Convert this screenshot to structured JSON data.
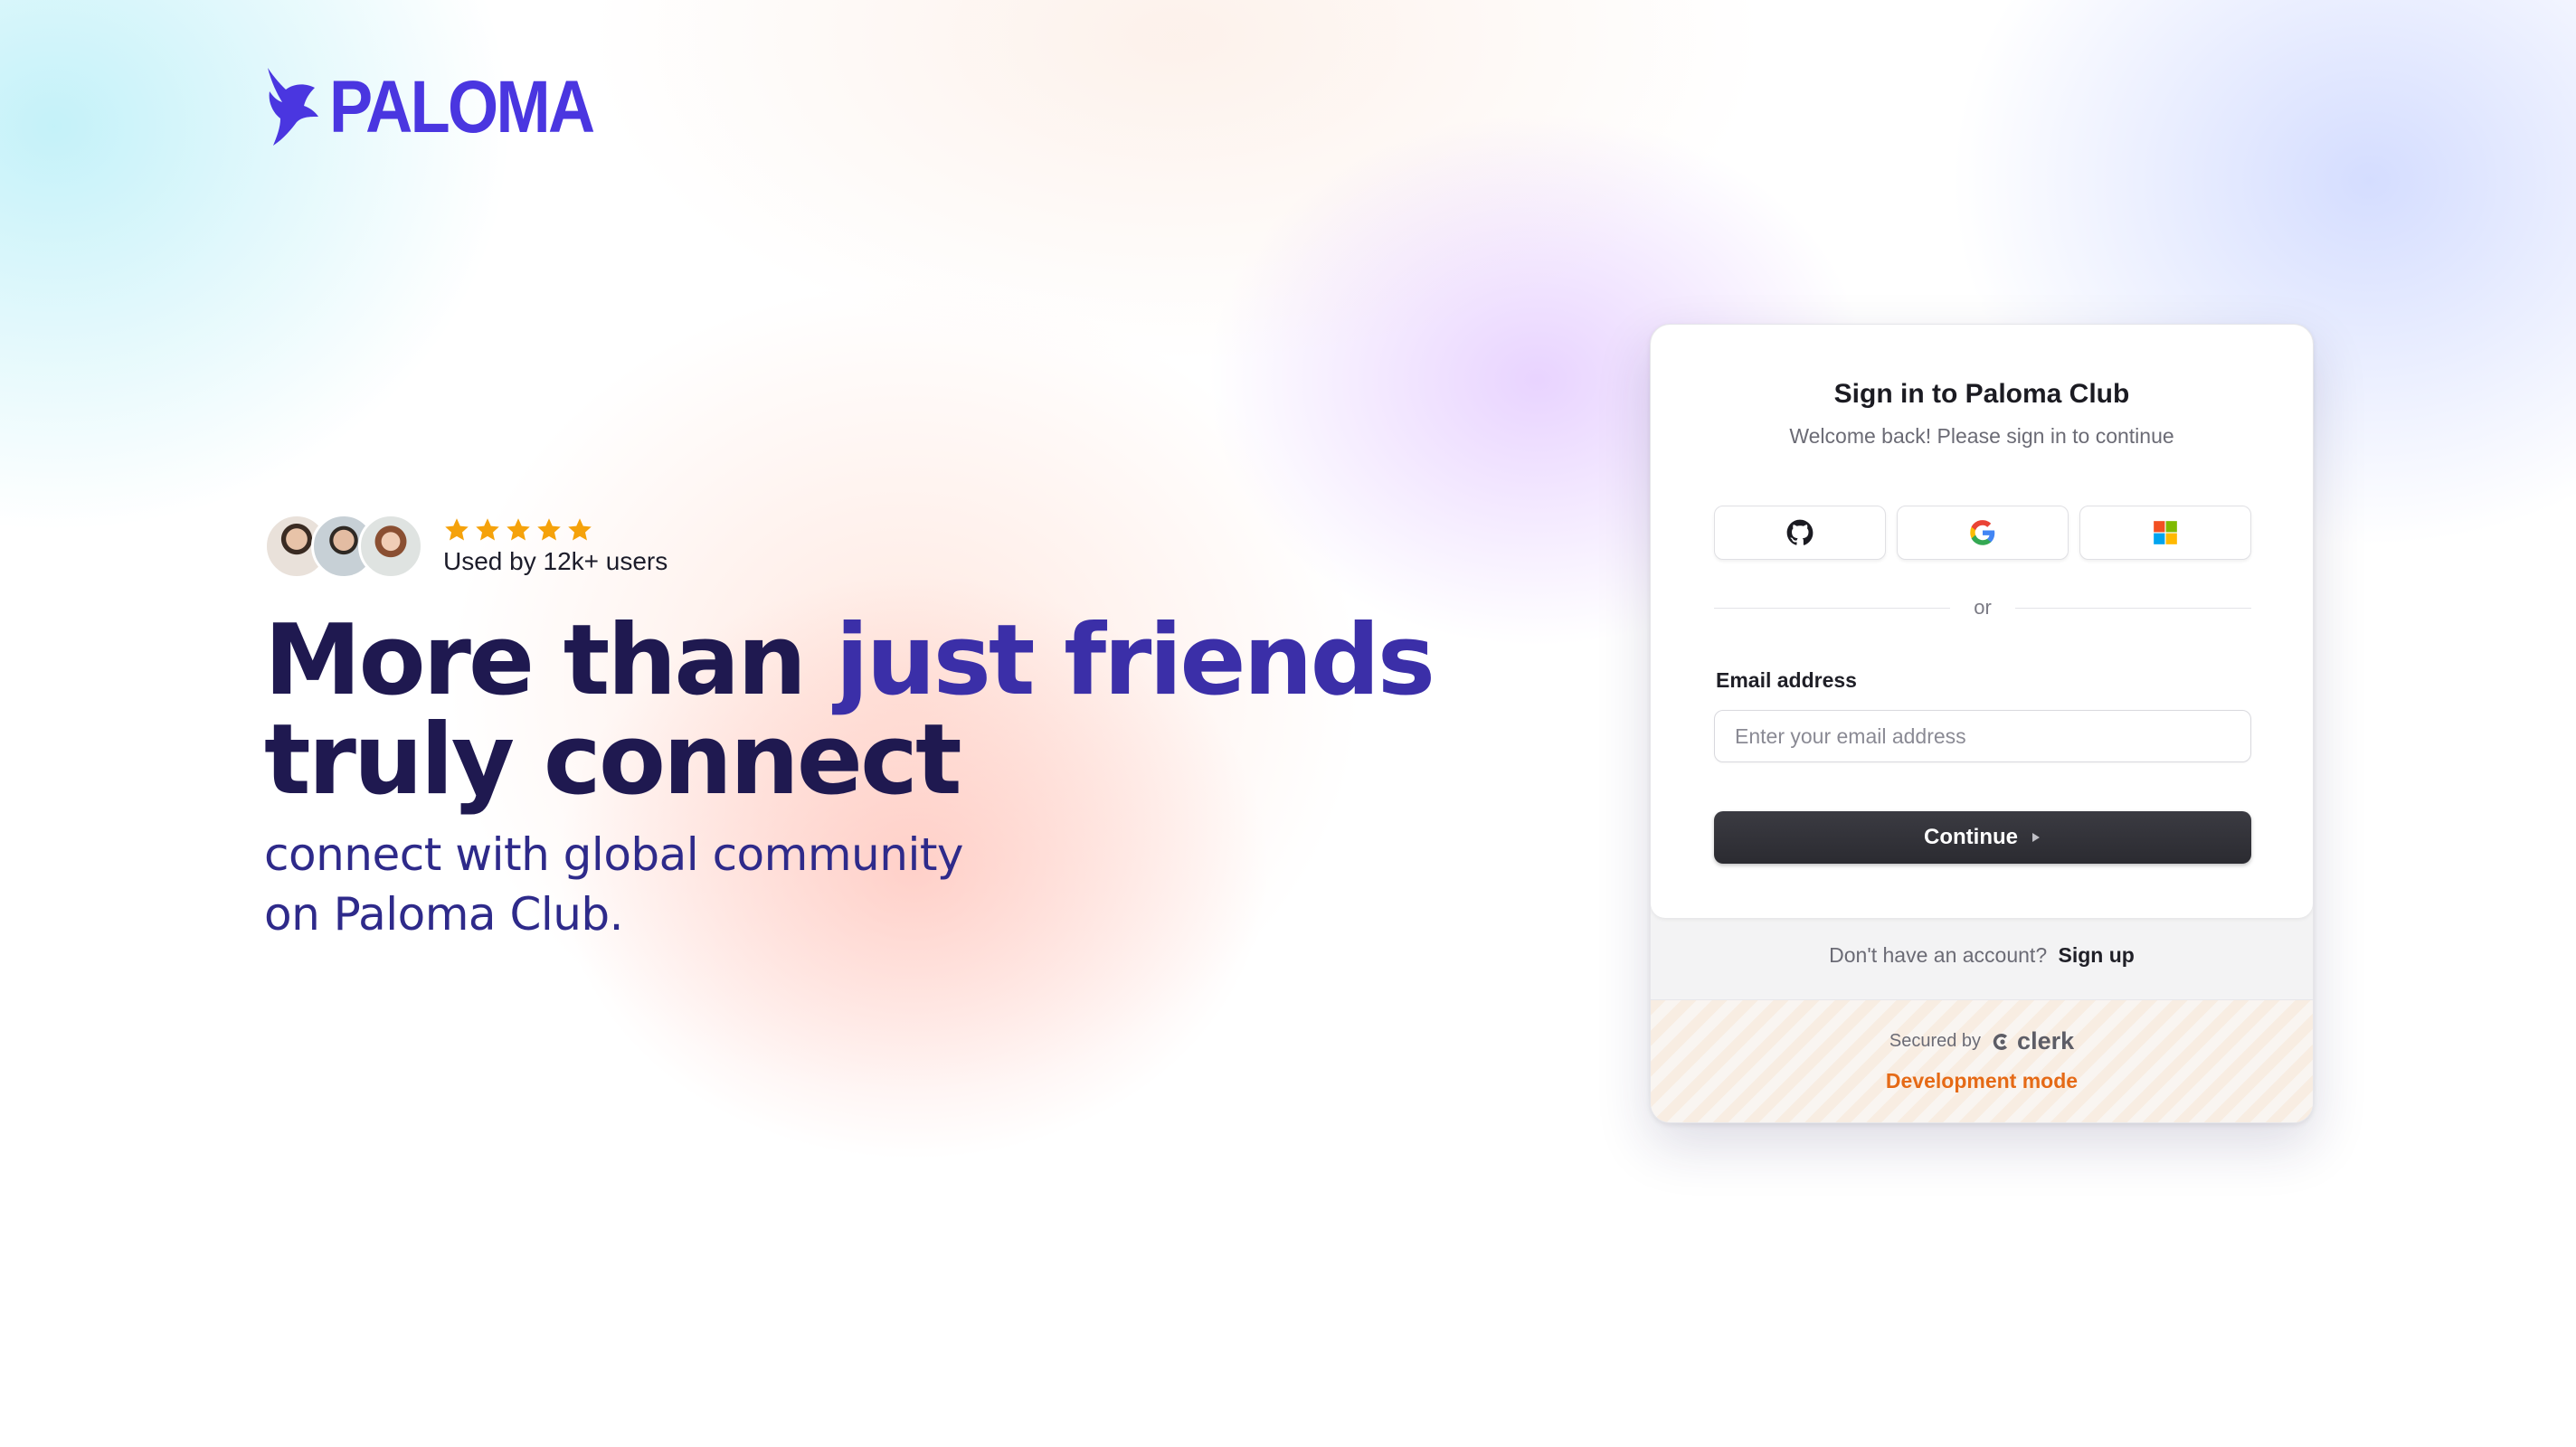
{
  "brand": {
    "name": "PALOMA",
    "color": "#4a36e0"
  },
  "social_proof": {
    "rating_stars": 5,
    "star_color": "#f5a20b",
    "users_text": "Used by 12k+ users"
  },
  "hero": {
    "headline_part1": "More than ",
    "headline_accent": "just friends",
    "headline_line2": "truly connect",
    "subline_line1": "connect with global community",
    "subline_line2": "on Paloma Club."
  },
  "signin": {
    "title": "Sign in to Paloma Club",
    "subtitle": "Welcome back! Please sign in to continue",
    "providers": [
      {
        "name": "github-icon"
      },
      {
        "name": "google-icon"
      },
      {
        "name": "microsoft-icon"
      }
    ],
    "divider_text": "or",
    "email_label": "Email address",
    "email_placeholder": "Enter your email address",
    "email_value": "",
    "continue_label": "Continue",
    "signup_prompt": "Don't have an account?",
    "signup_link": "Sign up",
    "secured_by": "Secured by",
    "clerk_name": "clerk",
    "dev_mode": "Development mode",
    "dev_mode_color": "#e56a16"
  }
}
